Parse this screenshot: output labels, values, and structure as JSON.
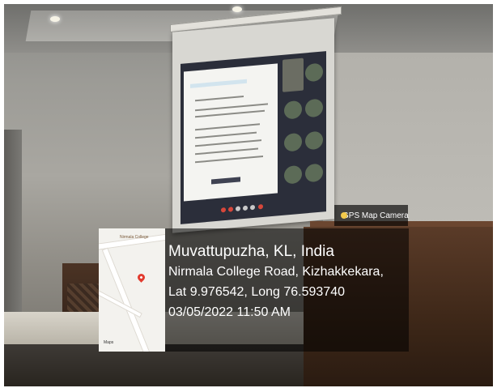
{
  "map": {
    "place_label": "Nirmala College",
    "logo": "Maps"
  },
  "brand": {
    "icon": "gps-map-camera-icon",
    "label": "GPS Map Camera"
  },
  "stamp": {
    "city": "Muvattupuzha, KL, India",
    "address": "Nirmala College Road, Kizhakkekara,",
    "coords": "Lat 9.976542, Long 76.593740",
    "datetime": "03/05/2022 11:50 AM"
  },
  "colors": {
    "pin": "#e23b2e",
    "overlay": "#000000"
  }
}
